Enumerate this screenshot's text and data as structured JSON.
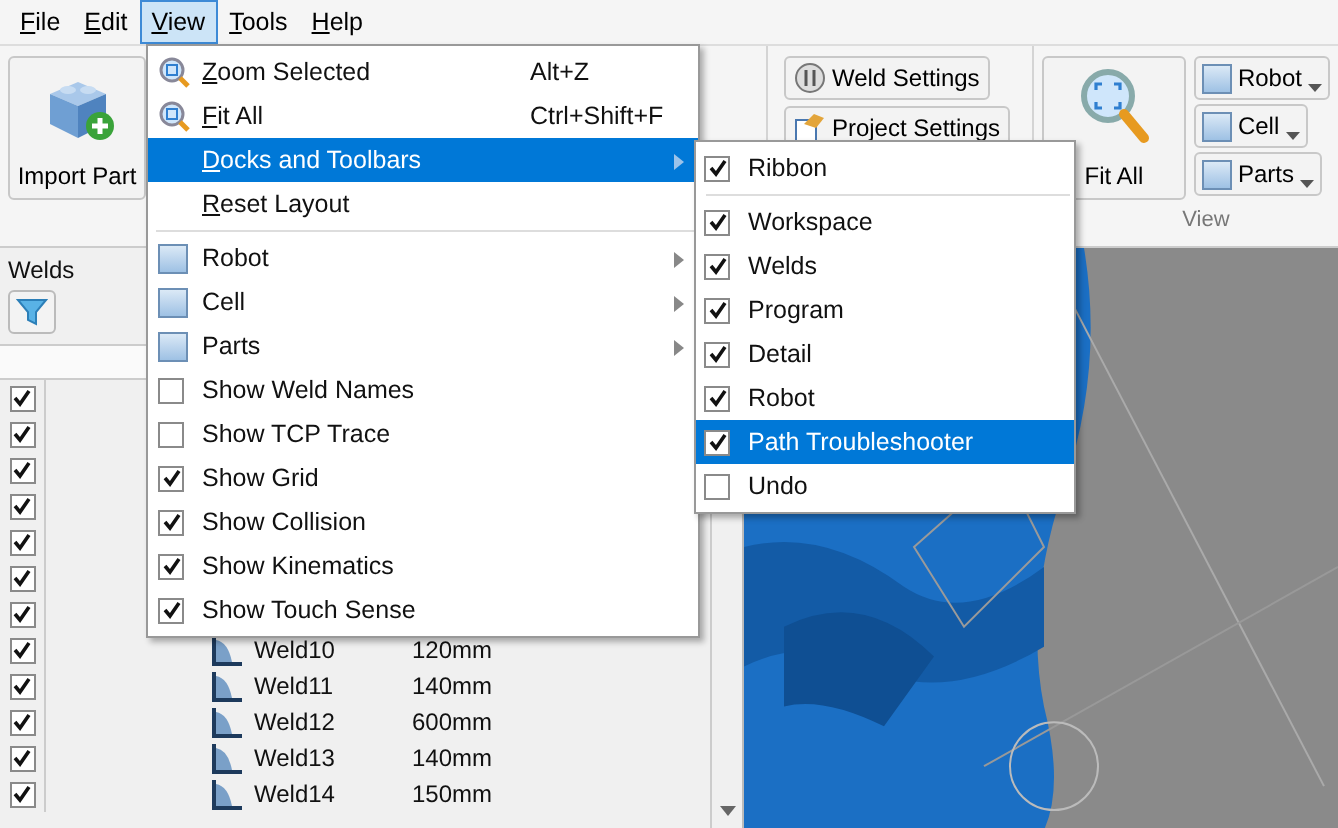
{
  "menubar": [
    {
      "label": "File",
      "selected": false
    },
    {
      "label": "Edit",
      "selected": false
    },
    {
      "label": "View",
      "selected": true
    },
    {
      "label": "Tools",
      "selected": false
    },
    {
      "label": "Help",
      "selected": false
    }
  ],
  "ribbon": {
    "import_part": "Import Part",
    "weld_settings": "Weld Settings",
    "project_settings": "Project Settings",
    "fit_all": "Fit All",
    "toggles": [
      "Robot",
      "Cell",
      "Parts"
    ],
    "group_label": "View"
  },
  "welds_panel": {
    "title": "Welds",
    "rows": [
      {
        "checked": true
      },
      {
        "checked": true
      },
      {
        "checked": true
      },
      {
        "checked": true
      },
      {
        "checked": true
      },
      {
        "checked": true
      },
      {
        "checked": true
      },
      {
        "checked": true,
        "name": "Weld10",
        "length": "120mm"
      },
      {
        "checked": true,
        "name": "Weld11",
        "length": "140mm"
      },
      {
        "checked": true,
        "name": "Weld12",
        "length": "600mm"
      },
      {
        "checked": true,
        "name": "Weld13",
        "length": "140mm"
      },
      {
        "checked": true,
        "name": "Weld14",
        "length": "150mm"
      }
    ]
  },
  "view_menu": {
    "items": [
      {
        "kind": "zoom",
        "label": "Zoom Selected",
        "shortcut": "Alt+Z",
        "selected": false
      },
      {
        "kind": "zoom",
        "label": "Fit All",
        "shortcut": "Ctrl+Shift+F",
        "selected": false
      },
      {
        "kind": "submenu",
        "label": "Docks and Toolbars",
        "selected": true
      },
      {
        "kind": "plain",
        "label": "Reset Layout",
        "selected": false
      },
      {
        "kind": "separator"
      },
      {
        "kind": "color_submenu",
        "label": "Robot",
        "selected": false
      },
      {
        "kind": "color_submenu",
        "label": "Cell",
        "selected": false
      },
      {
        "kind": "color_submenu",
        "label": "Parts",
        "selected": false
      },
      {
        "kind": "check",
        "label": "Show Weld Names",
        "checked": false,
        "selected": false
      },
      {
        "kind": "check",
        "label": "Show TCP Trace",
        "checked": false,
        "selected": false
      },
      {
        "kind": "check",
        "label": "Show Grid",
        "checked": true,
        "selected": false
      },
      {
        "kind": "check",
        "label": "Show Collision",
        "checked": true,
        "selected": false
      },
      {
        "kind": "check",
        "label": "Show Kinematics",
        "checked": true,
        "selected": false
      },
      {
        "kind": "check",
        "label": "Show Touch Sense",
        "checked": true,
        "selected": false
      }
    ]
  },
  "docks_submenu": {
    "items": [
      {
        "kind": "check",
        "label": "Ribbon",
        "checked": true,
        "selected": false
      },
      {
        "kind": "separator"
      },
      {
        "kind": "check",
        "label": "Workspace",
        "checked": true,
        "selected": false
      },
      {
        "kind": "check",
        "label": "Welds",
        "checked": true,
        "selected": false
      },
      {
        "kind": "check",
        "label": "Program",
        "checked": true,
        "selected": false
      },
      {
        "kind": "check",
        "label": "Detail",
        "checked": true,
        "selected": false
      },
      {
        "kind": "check",
        "label": "Robot",
        "checked": true,
        "selected": false
      },
      {
        "kind": "check",
        "label": "Path Troubleshooter",
        "checked": true,
        "selected": true
      },
      {
        "kind": "check",
        "label": "Undo",
        "checked": false,
        "selected": false
      }
    ]
  }
}
